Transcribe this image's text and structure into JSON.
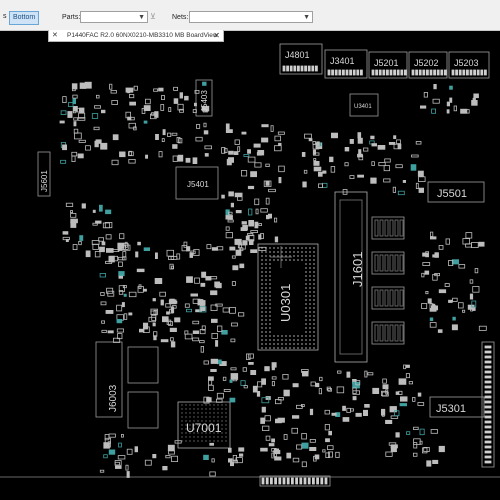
{
  "toolbar": {
    "side_partial": "s",
    "side_bottom": "Bottom",
    "parts_label": "Parts:",
    "parts_value": "",
    "net_label": "Nets:",
    "net_value": ""
  },
  "tab": {
    "title": "P1440FAC R2.0 60NX0210-MB3310 MB BoardView"
  },
  "board": {
    "components": [
      "J4801",
      "J3401",
      "J5201",
      "J5202",
      "J5203",
      "J5403",
      "J5601",
      "J5401",
      "J5501",
      "U0301",
      "J1601",
      "U3401",
      "J5301",
      "J6003",
      "U7001"
    ]
  },
  "colors": {
    "board_bg": "#000000",
    "outline": "#9a9a9a",
    "accent": "#1a4f86"
  }
}
